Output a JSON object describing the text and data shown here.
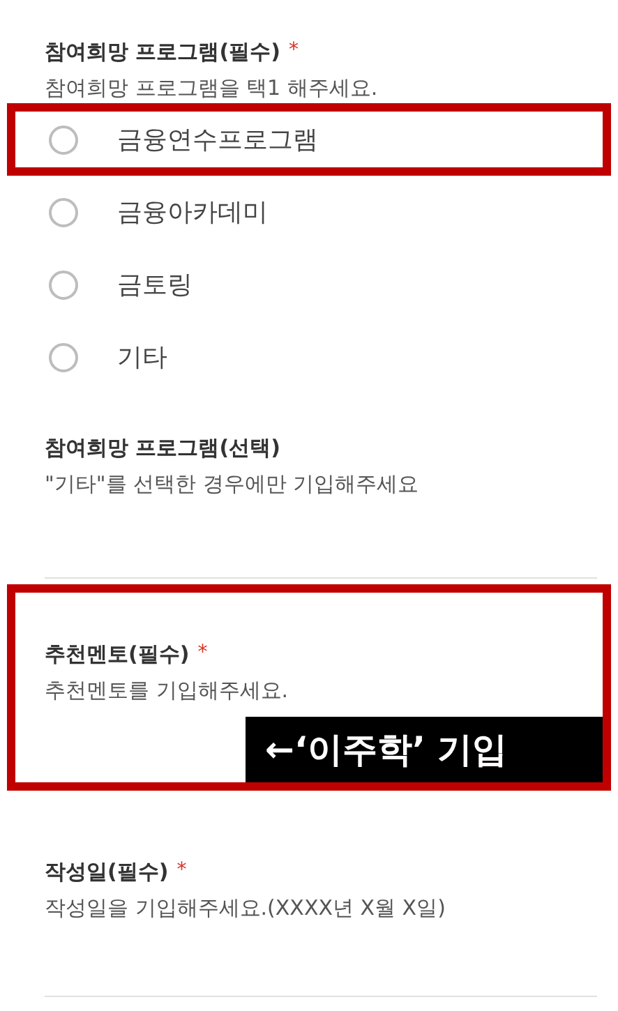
{
  "questions": [
    {
      "kind": "radio",
      "title": "참여희망 프로그램(필수)",
      "required_mark": "*",
      "description": "참여희망 프로그램을 택1 해주세요.",
      "highlighted": false,
      "options": [
        {
          "label": "금융연수프로그램",
          "selected": false,
          "highlighted": true
        },
        {
          "label": "금융아카데미",
          "selected": false,
          "highlighted": false
        },
        {
          "label": "금토링",
          "selected": false,
          "highlighted": false
        },
        {
          "label": "기타",
          "selected": false,
          "highlighted": false
        }
      ]
    },
    {
      "kind": "text",
      "title": "참여희망 프로그램(선택)",
      "description": "\"기타\"를 선택한 경우에만 기입해주세요",
      "highlighted": false,
      "field_line": true
    },
    {
      "kind": "text",
      "title": "추천멘토(필수)",
      "required_mark": "*",
      "description": "추천멘토를 기입해주세요.",
      "highlighted": true,
      "annotation": "←‘이주학’ 기입",
      "field_line": false
    },
    {
      "kind": "text",
      "title": "작성일(필수)",
      "required_mark": "*",
      "description": "작성일을 기입해주세요.(XXXX년 X월 X일)",
      "highlighted": false,
      "field_line": true
    }
  ]
}
